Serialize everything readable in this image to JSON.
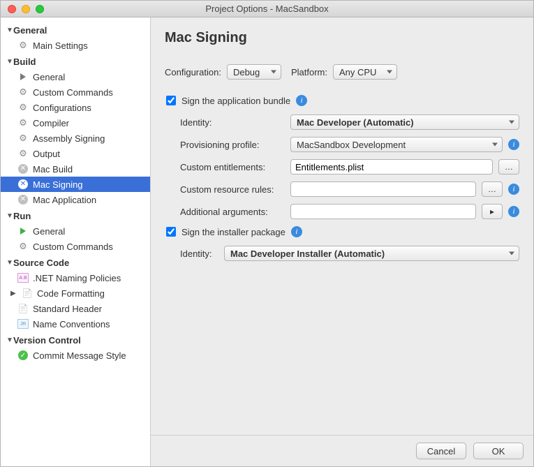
{
  "window": {
    "title": "Project Options - MacSandbox"
  },
  "sidebar": {
    "groups": [
      {
        "label": "General",
        "items": [
          {
            "label": "Main Settings",
            "icon": "gear"
          }
        ]
      },
      {
        "label": "Build",
        "items": [
          {
            "label": "General",
            "icon": "play"
          },
          {
            "label": "Custom Commands",
            "icon": "gear"
          },
          {
            "label": "Configurations",
            "icon": "gear"
          },
          {
            "label": "Compiler",
            "icon": "gear"
          },
          {
            "label": "Assembly Signing",
            "icon": "gear"
          },
          {
            "label": "Output",
            "icon": "gear"
          },
          {
            "label": "Mac Build",
            "icon": "circle-x"
          },
          {
            "label": "Mac Signing",
            "icon": "circle-x",
            "selected": true
          },
          {
            "label": "Mac Application",
            "icon": "circle-x"
          }
        ]
      },
      {
        "label": "Run",
        "items": [
          {
            "label": "General",
            "icon": "play-green"
          },
          {
            "label": "Custom Commands",
            "icon": "gear"
          }
        ]
      },
      {
        "label": "Source Code",
        "items": [
          {
            "label": ".NET Naming Policies",
            "icon": "abc"
          },
          {
            "label": "Code Formatting",
            "icon": "doc",
            "expandable": true
          },
          {
            "label": "Standard Header",
            "icon": "doc"
          },
          {
            "label": "Name Conventions",
            "icon": "jr"
          }
        ]
      },
      {
        "label": "Version Control",
        "items": [
          {
            "label": "Commit Message Style",
            "icon": "check"
          }
        ]
      }
    ]
  },
  "main": {
    "title": "Mac Signing",
    "config": {
      "configuration_label": "Configuration:",
      "configuration_value": "Debug",
      "platform_label": "Platform:",
      "platform_value": "Any CPU"
    },
    "app_bundle": {
      "check_label": "Sign the application bundle",
      "checked": true,
      "identity_label": "Identity:",
      "identity_value": "Mac Developer (Automatic)",
      "provisioning_label": "Provisioning profile:",
      "provisioning_value": "MacSandbox Development",
      "entitlements_label": "Custom entitlements:",
      "entitlements_value": "Entitlements.plist",
      "resource_rules_label": "Custom resource rules:",
      "resource_rules_value": "",
      "additional_args_label": "Additional arguments:",
      "additional_args_value": ""
    },
    "installer": {
      "check_label": "Sign the installer package",
      "checked": true,
      "identity_label": "Identity:",
      "identity_value": "Mac Developer Installer (Automatic)"
    }
  },
  "footer": {
    "cancel": "Cancel",
    "ok": "OK"
  }
}
